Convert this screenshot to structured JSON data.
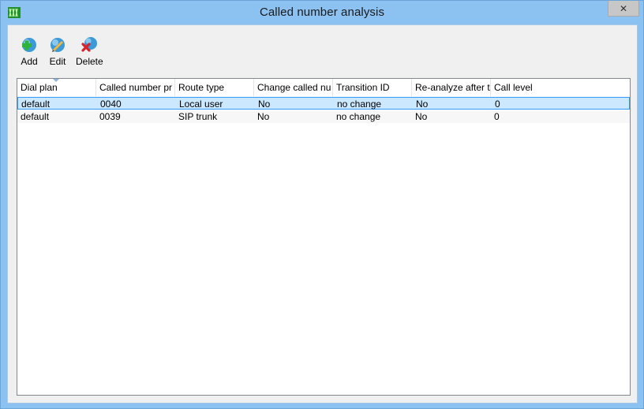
{
  "window": {
    "title": "Called number analysis",
    "close_label": "✕"
  },
  "toolbar": {
    "add_label": "Add",
    "edit_label": "Edit",
    "delete_label": "Delete"
  },
  "table": {
    "columns": [
      "Dial plan",
      "Called number pr",
      "Route type",
      "Change called nu",
      "Transition ID",
      "Re-analyze after t",
      "Call level"
    ],
    "rows": [
      [
        "default",
        "0040",
        "Local user",
        "No",
        "no change",
        "No",
        "0"
      ],
      [
        "default",
        "0039",
        "SIP trunk",
        "No",
        "no change",
        "No",
        "0"
      ]
    ],
    "selected_row": 0
  },
  "colors": {
    "title_bar": "#8cc2f2",
    "selection_fill": "#cce8ff",
    "selection_border": "#3399ff"
  }
}
